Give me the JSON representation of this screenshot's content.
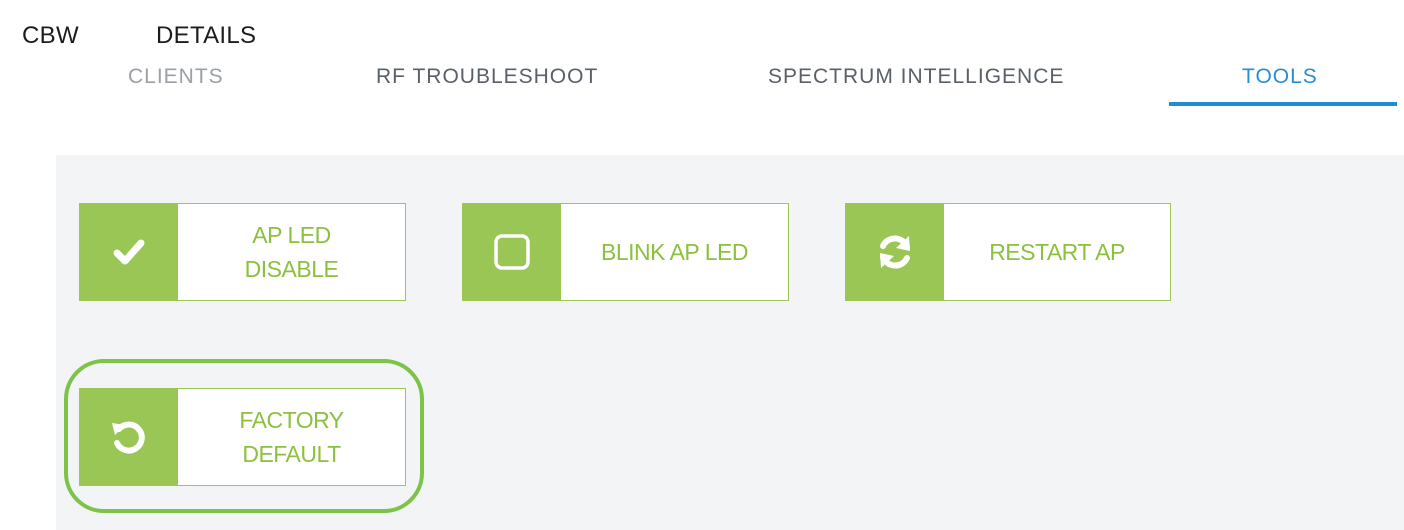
{
  "header": {
    "brand": "CBW",
    "title": "DETAILS"
  },
  "tabs": [
    {
      "label": "CLIENTS",
      "active": false
    },
    {
      "label": "RF TROUBLESHOOT",
      "active": false
    },
    {
      "label": "SPECTRUM INTELLIGENCE",
      "active": false
    },
    {
      "label": "TOOLS",
      "active": true
    }
  ],
  "tools": {
    "ap_led": {
      "label_line1": "AP LED",
      "label_line2": "DISABLE",
      "icon": "checkmark-icon"
    },
    "blink": {
      "label": "BLINK AP LED",
      "icon": "checkbox-icon"
    },
    "restart": {
      "label": "RESTART AP",
      "icon": "refresh-icon"
    },
    "factory": {
      "label_line1": "FACTORY",
      "label_line2": "DEFAULT",
      "icon": "reset-icon"
    }
  },
  "colors": {
    "accent_green": "#99c655",
    "label_green": "#8cc03f",
    "active_tab_blue": "#1f8dd6",
    "highlight_ring": "#7dc249"
  }
}
